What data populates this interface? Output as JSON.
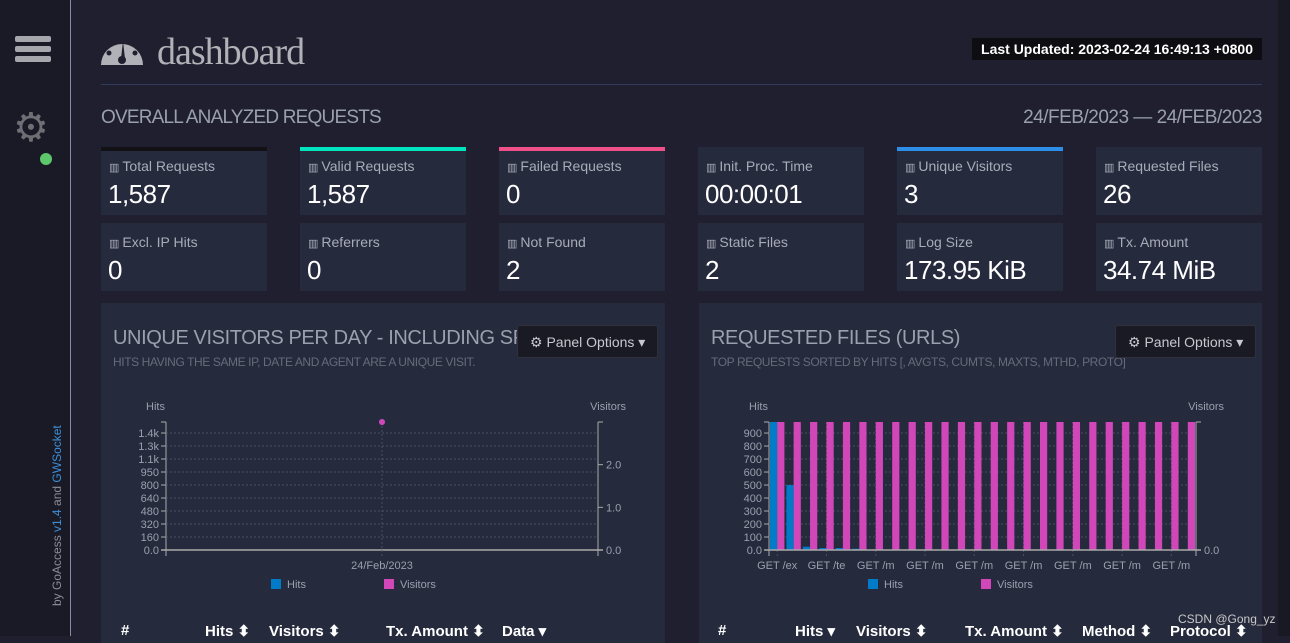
{
  "sidebar": {
    "credit_by": "by GoAccess ",
    "version": "v1.4",
    "credit_and": " and ",
    "gwsocket": "GWSocket",
    "status_color": "#5cc86b"
  },
  "header": {
    "title": "dashboard",
    "last_updated": "Last Updated: 2023-02-24 16:49:13 +0800"
  },
  "overall": {
    "title": "OVERALL ANALYZED REQUESTS",
    "date_range": "24/FEB/2023 — 24/FEB/2023"
  },
  "cards": [
    {
      "label": "Total Requests",
      "value": "1,587",
      "accent": "#111116"
    },
    {
      "label": "Valid Requests",
      "value": "1,587",
      "accent": "#00e5c0"
    },
    {
      "label": "Failed Requests",
      "value": "0",
      "accent": "#f0508a"
    },
    {
      "label": "Init. Proc. Time",
      "value": "00:00:01",
      "accent": ""
    },
    {
      "label": "Unique Visitors",
      "value": "3",
      "accent": "#2d8ee8"
    },
    {
      "label": "Requested Files",
      "value": "26",
      "accent": ""
    },
    {
      "label": "Excl. IP Hits",
      "value": "0",
      "accent": ""
    },
    {
      "label": "Referrers",
      "value": "0",
      "accent": ""
    },
    {
      "label": "Not Found",
      "value": "2",
      "accent": ""
    },
    {
      "label": "Static Files",
      "value": "2",
      "accent": ""
    },
    {
      "label": "Log Size",
      "value": "173.95 KiB",
      "accent": ""
    },
    {
      "label": "Tx. Amount",
      "value": "34.74 MiB",
      "accent": ""
    }
  ],
  "panels": [
    {
      "title": "UNIQUE VISITORS PER DAY - INCLUDING SPIDERS",
      "subtitle": "HITS HAVING THE SAME IP, DATE AND AGENT ARE A UNIQUE VISIT.",
      "options": "Panel Options",
      "columns": [
        "#",
        "Hits",
        "Visitors",
        "Tx. Amount",
        "Data"
      ]
    },
    {
      "title": "REQUESTED FILES (URLS)",
      "subtitle": "TOP REQUESTS SORTED BY HITS [, AVGTS, CUMTS, MAXTS, MTHD, PROTO]",
      "options": "Panel Options",
      "columns": [
        "#",
        "Hits",
        "Visitors",
        "Tx. Amount",
        "Method",
        "Protocol"
      ]
    }
  ],
  "chart_data": [
    {
      "type": "line",
      "ylabel": "Hits",
      "y2label": "Visitors",
      "categories": [
        "24/Feb/2023"
      ],
      "series": [
        {
          "name": "Hits",
          "values": [
            1587
          ],
          "color": "#007bc8"
        },
        {
          "name": "Visitors",
          "values": [
            3
          ],
          "color": "#d146b9"
        }
      ],
      "yticks": [
        "0.0",
        "160",
        "320",
        "480",
        "640",
        "800",
        "950",
        "1.1k",
        "1.3k",
        "1.4k"
      ],
      "ylim": [
        0,
        1587
      ],
      "y2ticks": [
        "0.0",
        "1.0",
        "2.0"
      ],
      "y2lim": [
        0,
        3
      ],
      "grid": true,
      "legend": "bottom"
    },
    {
      "type": "bar",
      "ylabel": "Hits",
      "y2label": "Visitors",
      "categories": [
        "GET /ex",
        "",
        "",
        "GET /te",
        "",
        "",
        "GET /m",
        "",
        "",
        "GET /m",
        "",
        "",
        "GET /m",
        "",
        "",
        "GET /m",
        "",
        "",
        "GET /m",
        "",
        "",
        "GET /m",
        "",
        "",
        "GET /m",
        ""
      ],
      "series": [
        {
          "name": "Hits",
          "values": [
            1000,
            500,
            25,
            15,
            15,
            10,
            1,
            1,
            1,
            1,
            1,
            1,
            1,
            1,
            1,
            1,
            1,
            1,
            1,
            1,
            1,
            1,
            1,
            1,
            1,
            1
          ],
          "color": "#007bc8"
        },
        {
          "name": "Visitors",
          "values": [
            1,
            1,
            1,
            1,
            1,
            1,
            1,
            1,
            1,
            1,
            1,
            1,
            1,
            1,
            1,
            1,
            1,
            1,
            1,
            1,
            1,
            1,
            1,
            1,
            1,
            1
          ],
          "color": "#d146b9"
        }
      ],
      "yticks": [
        "0.0",
        "100",
        "200",
        "300",
        "400",
        "500",
        "600",
        "700",
        "800",
        "900"
      ],
      "ylim": [
        0,
        985
      ],
      "y2ticks": [
        "0.0"
      ],
      "y2lim": [
        0,
        1
      ],
      "grid": true,
      "legend": "bottom"
    }
  ],
  "watermark": "CSDN @Gong_yz"
}
